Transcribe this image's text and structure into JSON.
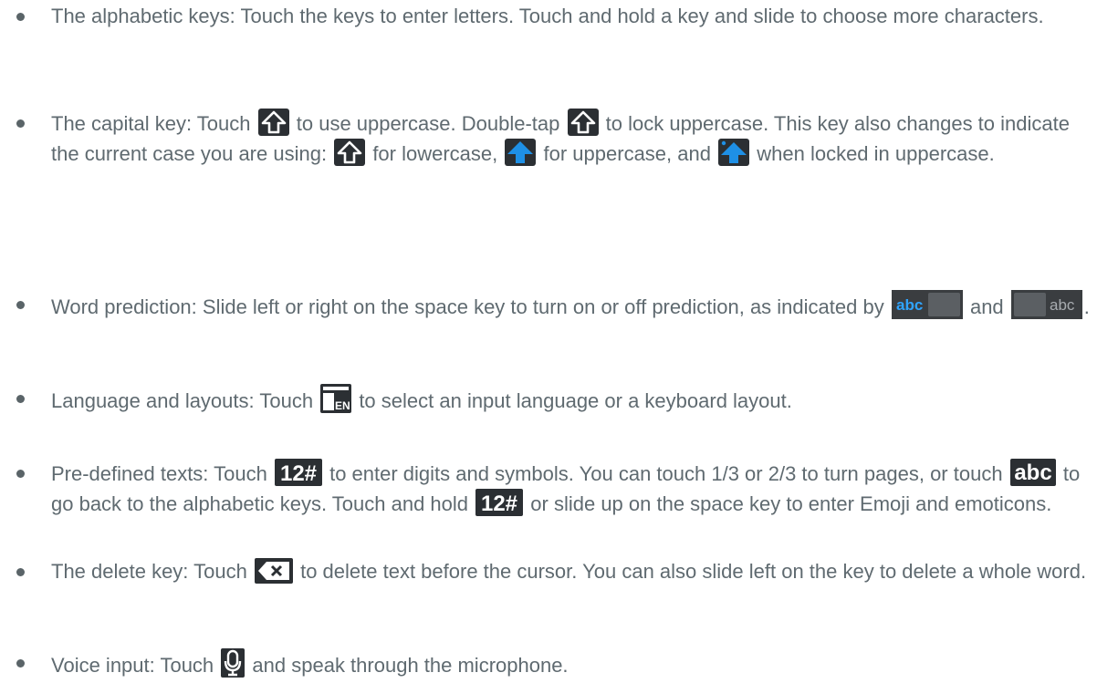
{
  "items": [
    {
      "text": [
        "The alphabetic keys: Touch the keys to enter letters. Touch and hold a key and slide to choose more characters."
      ]
    },
    {
      "p1": "The capital key: Touch",
      "p2": "to use uppercase. Double-tap",
      "p3": "to lock uppercase. This key also changes to indicate the current case you are using:",
      "p4": "for lowercase,",
      "p5": "for uppercase, and",
      "p6": "when locked in uppercase."
    },
    {
      "p1": "Word prediction: Slide left or right on the space key to turn on or off prediction, as indicated by",
      "icon1_text": "abc",
      "p2": "and",
      "icon2_text": "abc",
      "p3": "."
    },
    {
      "p1": "Language and layouts: Touch",
      "icon_text": "EN",
      "p2": "to select an input language or a keyboard layout."
    },
    {
      "p1": "Pre-defined texts: Touch",
      "icon1_text": "12#",
      "p2": "to enter digits and symbols. You can touch 1/3 or 2/3 to turn pages, or touch",
      "icon2_text": "abc",
      "p3": "to go back to the alphabetic keys. Touch and hold",
      "icon3_text": "12#",
      "p4": "or slide up on the space key to enter Emoji and emoticons."
    },
    {
      "p1": "The delete key: Touch",
      "p2": "to delete text before the cursor. You can also slide left on the key to delete a whole word."
    },
    {
      "p1": "Voice input: Touch",
      "p2": "and speak through the microphone."
    }
  ],
  "colors": {
    "text": "#5f6a70",
    "bullet": "#5a6468",
    "icon_dark": "#2b2f33",
    "accent_blue": "#1e90e6"
  },
  "icons": [
    "shift-outline-icon",
    "shift-filled-icon",
    "shift-locked-icon",
    "prediction-on-icon",
    "prediction-off-icon",
    "language-layout-icon",
    "symbols-key-icon",
    "abc-key-icon",
    "delete-key-icon",
    "microphone-icon"
  ]
}
